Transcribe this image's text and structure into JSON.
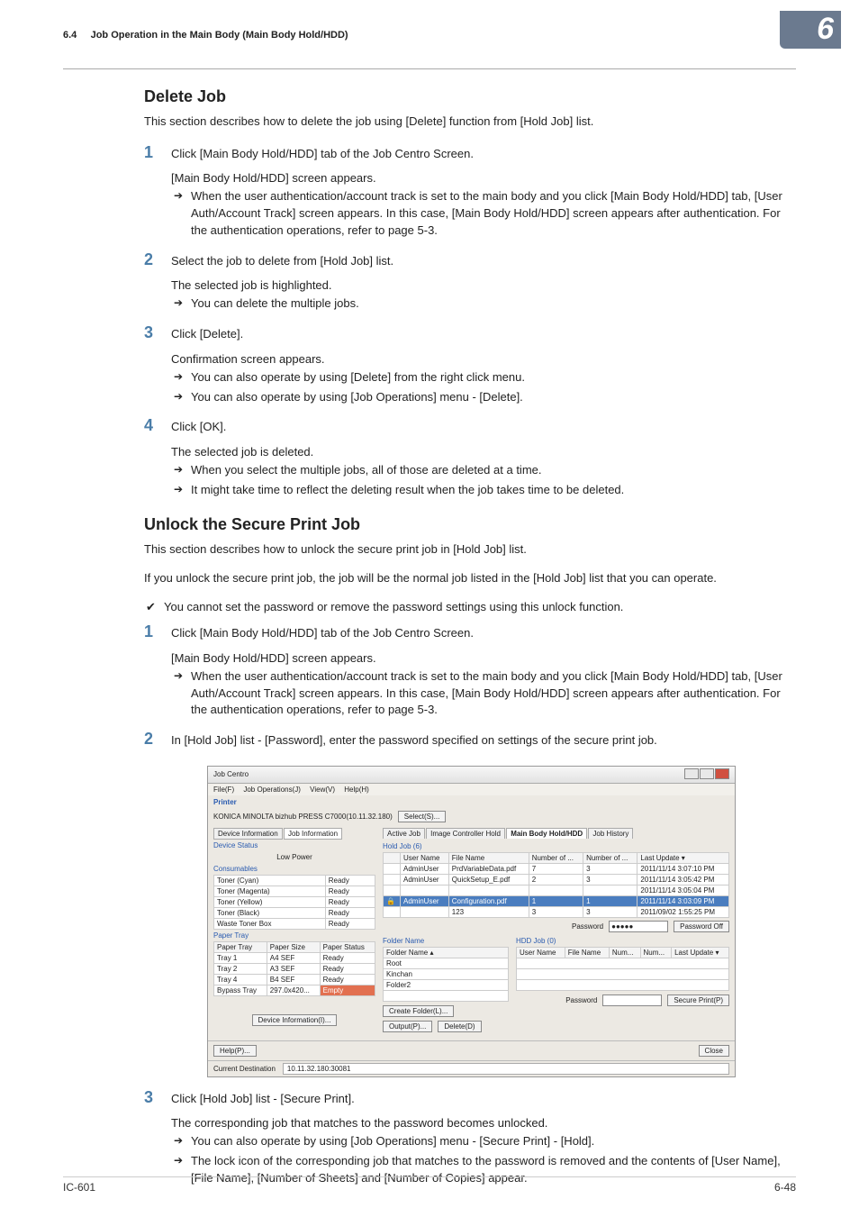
{
  "header": {
    "section": "6.4",
    "title": "Job Operation in the Main Body (Main Body Hold/HDD)",
    "chapter": "6"
  },
  "delete_job": {
    "heading": "Delete Job",
    "intro": "This section describes how to delete the job using [Delete] function from [Hold Job] list.",
    "steps": [
      {
        "num": "1",
        "title": "Click [Main Body Hold/HDD] tab of the Job Centro Screen.",
        "sub_text": "[Main Body Hold/HDD] screen appears.",
        "arrows": [
          "When the user authentication/account track is set to the main body and you click [Main Body Hold/HDD] tab, [User Auth/Account Track] screen appears. In this case, [Main Body Hold/HDD] screen appears after authentication. For the authentication operations, refer to page 5-3."
        ]
      },
      {
        "num": "2",
        "title": "Select the job to delete from [Hold Job] list.",
        "sub_text": "The selected job is highlighted.",
        "arrows": [
          "You can delete the multiple jobs."
        ]
      },
      {
        "num": "3",
        "title": "Click [Delete].",
        "sub_text": "Confirmation screen appears.",
        "arrows": [
          "You can also operate by using [Delete] from the right click menu.",
          "You can also operate by using [Job Operations] menu - [Delete]."
        ]
      },
      {
        "num": "4",
        "title": "Click [OK].",
        "sub_text": "The selected job is deleted.",
        "arrows": [
          "When you select the multiple jobs, all of those are deleted at a time.",
          "It might take time to reflect the deleting result when the job takes time to be deleted."
        ]
      }
    ]
  },
  "unlock_job": {
    "heading": "Unlock the Secure Print Job",
    "intro1": "This section describes how to unlock the secure print job in [Hold Job] list.",
    "intro2": "If you unlock the secure print job, the job will be the normal job listed in the [Hold Job] list that you can operate.",
    "note": "You cannot set the password or remove the password settings using this unlock function.",
    "steps_a": [
      {
        "num": "1",
        "title": "Click [Main Body Hold/HDD] tab of the Job Centro Screen.",
        "sub_text": "[Main Body Hold/HDD] screen appears.",
        "arrows": [
          "When the user authentication/account track is set to the main body and you click [Main Body Hold/HDD] tab, [User Auth/Account Track] screen appears. In this case, [Main Body Hold/HDD] screen appears after authentication. For the authentication operations, refer to page 5-3."
        ]
      },
      {
        "num": "2",
        "title": "In [Hold Job] list - [Password], enter the password specified on settings of the secure print job."
      }
    ],
    "steps_b": [
      {
        "num": "3",
        "title": "Click [Hold Job] list - [Secure Print].",
        "sub_text": "The corresponding job that matches to the password becomes unlocked.",
        "arrows": [
          "You can also operate by using [Job Operations] menu - [Secure Print] - [Hold].",
          "The lock icon of the corresponding job that matches to the password is removed and the contents of [User Name], [File Name], [Number of Sheets] and [Number of Copies] appear."
        ]
      }
    ]
  },
  "screenshot": {
    "window_title": "Job Centro",
    "menu": [
      "File(F)",
      "Job Operations(J)",
      "View(V)",
      "Help(H)"
    ],
    "printer_label": "Printer",
    "printer_name": "KONICA MINOLTA bizhub PRESS C7000(10.11.32.180)",
    "select_btn": "Select(S)...",
    "left": {
      "tab1": "Device Information",
      "tab2": "Job Information",
      "device_status_label": "Device Status",
      "device_status_value": "Low Power",
      "consumables_label": "Consumables",
      "consumables": [
        [
          "Toner (Cyan)",
          "Ready"
        ],
        [
          "Toner (Magenta)",
          "Ready"
        ],
        [
          "Toner (Yellow)",
          "Ready"
        ],
        [
          "Toner (Black)",
          "Ready"
        ],
        [
          "Waste Toner Box",
          "Ready"
        ]
      ],
      "paper_tray_label": "Paper Tray",
      "paper_headers": [
        "Paper Tray",
        "Paper Size",
        "Paper Status"
      ],
      "paper_trays": [
        [
          "Tray 1",
          "A4 SEF",
          "Ready"
        ],
        [
          "Tray 2",
          "A3 SEF",
          "Ready"
        ],
        [
          "Tray 4",
          "B4 SEF",
          "Ready"
        ],
        [
          "Bypass Tray",
          "297.0x420...",
          "Empty"
        ]
      ],
      "device_info_btn": "Device Information(I)..."
    },
    "right": {
      "tabs": [
        "Active Job",
        "Image Controller Hold",
        "Main Body Hold/HDD",
        "Job History"
      ],
      "hold_job_label": "Hold Job (6)",
      "hold_headers": [
        "",
        "User Name",
        "File Name",
        "Number of ...",
        "Number of ...",
        "Last Update ▾"
      ],
      "hold_rows": [
        [
          "",
          "AdminUser",
          "PrdVariableData.pdf",
          "7",
          "3",
          "2011/11/14 3:07:10 PM"
        ],
        [
          "",
          "AdminUser",
          "QuickSetup_E.pdf",
          "2",
          "3",
          "2011/11/14 3:05:42 PM"
        ],
        [
          "",
          "",
          "",
          "",
          "",
          "2011/11/14 3:05:04 PM"
        ],
        [
          "🔒",
          "AdminUser",
          "Configuration.pdf",
          "1",
          "1",
          "2011/11/14 3:03:09 PM"
        ],
        [
          "",
          "",
          "123",
          "3",
          "3",
          "2011/09/02 1:55:25 PM"
        ]
      ],
      "password_label": "Password",
      "password_value": "●●●●●",
      "password_off_btn": "Password Off",
      "folder_label": "Folder Name",
      "hdd_label": "HDD Job (0)",
      "folder_header": "Folder Name ▴",
      "folders": [
        "Root",
        "Kinchan",
        "Folder2"
      ],
      "hdd_headers": [
        "User Name",
        "File Name",
        "Num...",
        "Num...",
        "Last Update ▾"
      ],
      "create_folder_btn": "Create Folder(L)...",
      "hdd_password_label": "Password",
      "secure_print_btn": "Secure Print(P)",
      "output_btn": "Output(P)...",
      "delete_btn": "Delete(D)"
    },
    "footer": {
      "help_btn": "Help(P)...",
      "close_btn": "Close",
      "status_label": "Current Destination",
      "status_value": "10.11.32.180:30081"
    }
  },
  "page_footer": {
    "left": "IC-601",
    "right": "6-48"
  }
}
